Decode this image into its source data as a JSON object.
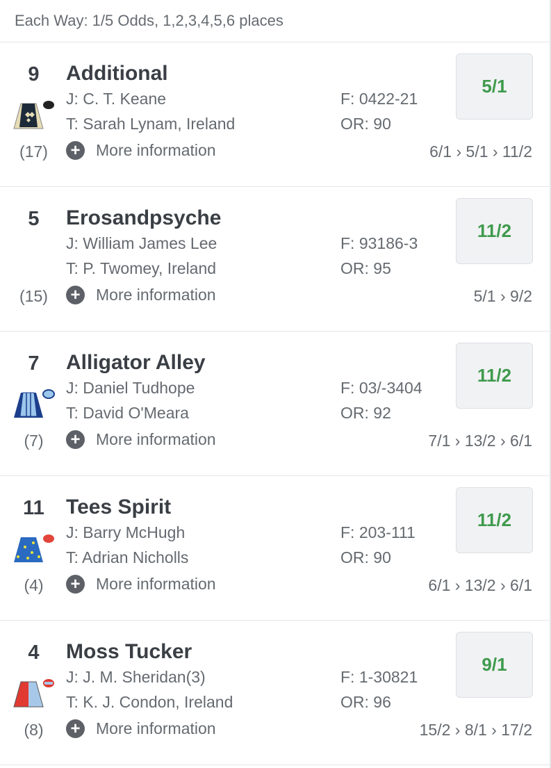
{
  "header": {
    "each_way": "Each Way: 1/5 Odds, 1,2,3,4,5,6 places"
  },
  "more_label": "More information",
  "runners": [
    {
      "number": "9",
      "name": "Additional",
      "jockey": "J: C. T. Keane",
      "trainer": "T: Sarah Lynam, Ireland",
      "form": "F: 0422-21",
      "rating": "OR: 90",
      "draw": "(17)",
      "odds": "5/1",
      "history": "6/1 › 5/1 › 11/2",
      "silk_colors": {
        "body": "#1d2a3a",
        "sleeves": "#e6dcb5",
        "cap": "#222222"
      }
    },
    {
      "number": "5",
      "name": "Erosandpsyche",
      "jockey": "J: William James Lee",
      "trainer": "T: P. Twomey, Ireland",
      "form": "F: 93186-3",
      "rating": "OR: 95",
      "draw": "(15)",
      "odds": "11/2",
      "history": "5/1 › 9/2",
      "silk_colors": null
    },
    {
      "number": "7",
      "name": "Alligator Alley",
      "jockey": "J: Daniel Tudhope",
      "trainer": "T: David O'Meara",
      "form": "F: 03/-3404",
      "rating": "OR: 92",
      "draw": "(7)",
      "odds": "11/2",
      "history": "7/1 › 13/2 › 6/1",
      "silk_colors": {
        "body": "#9cc7ec",
        "sleeves": "#1c3f8c",
        "cap": "#9cc7ec"
      }
    },
    {
      "number": "11",
      "name": "Tees Spirit",
      "jockey": "J: Barry McHugh",
      "trainer": "T: Adrian Nicholls",
      "form": "F: 203-111",
      "rating": "OR: 90",
      "draw": "(4)",
      "odds": "11/2",
      "history": "6/1 › 13/2 › 6/1",
      "silk_colors": {
        "body": "#2a6ac0",
        "sleeves": "#2a6ac0",
        "cap": "#e2453a"
      }
    },
    {
      "number": "4",
      "name": "Moss Tucker",
      "jockey": "J: J. M. Sheridan(3)",
      "trainer": "T: K. J. Condon, Ireland",
      "form": "F: 1-30821",
      "rating": "OR: 96",
      "draw": "(8)",
      "odds": "9/1",
      "history": "15/2 › 8/1 › 17/2",
      "silk_colors": {
        "body": "#e03a32",
        "sleeves": "#a8c8ea",
        "cap": "#e03a32"
      }
    }
  ]
}
